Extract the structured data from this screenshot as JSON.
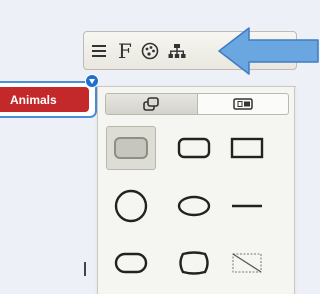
{
  "node": {
    "label": "Animals"
  },
  "toolbar": {
    "font_button_glyph": "F",
    "buttons": [
      "menu-icon",
      "font-icon",
      "color-palette-icon",
      "layout-icon"
    ]
  },
  "panel": {
    "tabs": [
      "shape-icon",
      "preset-icon"
    ],
    "shapes": [
      "rounded-rectangle-filled",
      "rounded-rectangle",
      "rectangle",
      "circle",
      "ellipse",
      "line",
      "stadium",
      "barrel",
      "no-shape"
    ],
    "selected_shape": "rounded-rectangle-filled"
  },
  "colors": {
    "node_fill": "#c3282b",
    "selection_blue": "#4a8fd9",
    "arrow_blue": "#6aa6e0"
  }
}
